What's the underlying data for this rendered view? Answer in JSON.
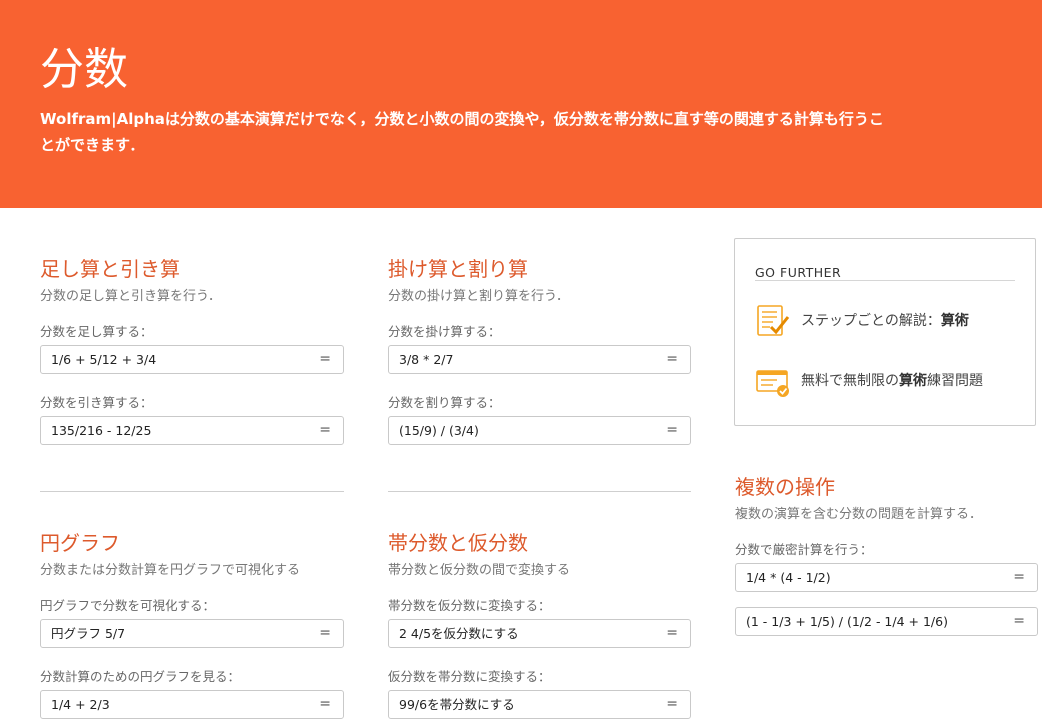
{
  "header": {
    "title": "分数",
    "description": "Wolfram|Alphaは分数の基本演算だけでなく，分数と小数の間の変換や，仮分数を帯分数に直す等の関連する計算も行うことができます．"
  },
  "sections": {
    "add_sub": {
      "title": "足し算と引き算",
      "description": "分数の足し算と引き算を行う．",
      "fields": [
        {
          "label": "分数を足し算する：",
          "value": "1/6 + 5/12 + 3/4"
        },
        {
          "label": "分数を引き算する：",
          "value": "135/216 - 12/25"
        }
      ]
    },
    "mul_div": {
      "title": "掛け算と割り算",
      "description": "分数の掛け算と割り算を行う．",
      "fields": [
        {
          "label": "分数を掛け算する：",
          "value": "3/8 * 2/7"
        },
        {
          "label": "分数を割り算する：",
          "value": "(15/9) / (3/4)"
        }
      ]
    },
    "pie": {
      "title": "円グラフ",
      "description": "分数または分数計算を円グラフで可視化する",
      "fields": [
        {
          "label": "円グラフで分数を可視化する：",
          "value": "円グラフ 5/7"
        },
        {
          "label": "分数計算のための円グラフを見る：",
          "value": "1/4 + 2/3"
        }
      ]
    },
    "mixed": {
      "title": "帯分数と仮分数",
      "description": "帯分数と仮分数の間で変換する",
      "fields": [
        {
          "label": "帯分数を仮分数に変換する：",
          "value": "2 4/5を仮分数にする"
        },
        {
          "label": "仮分数を帯分数に変換する：",
          "value": "99/6を帯分数にする"
        }
      ]
    },
    "multi_ops": {
      "title": "複数の操作",
      "description": "複数の演算を含む分数の問題を計算する．",
      "fields": [
        {
          "label": "分数で厳密計算を行う：",
          "value": "1/4 * (4 - 1/2)"
        },
        {
          "label": "",
          "value": "(1 - 1/3 + 1/5) / (1/2 - 1/4 + 1/6)"
        }
      ]
    }
  },
  "equals_symbol": "=",
  "go_further": {
    "heading": "GO FURTHER",
    "items": [
      {
        "prefix": "ステップごとの解説：",
        "bold": "算術",
        "suffix": "",
        "icon": "step-by-step-checklist-icon"
      },
      {
        "prefix": "無料で無制限の",
        "bold": "算術",
        "suffix": "練習問題",
        "icon": "practice-problems-icon"
      }
    ]
  },
  "colors": {
    "hero_bg": "#f86231",
    "accent": "#dd5a2c",
    "icon_orange": "#f5a623"
  }
}
